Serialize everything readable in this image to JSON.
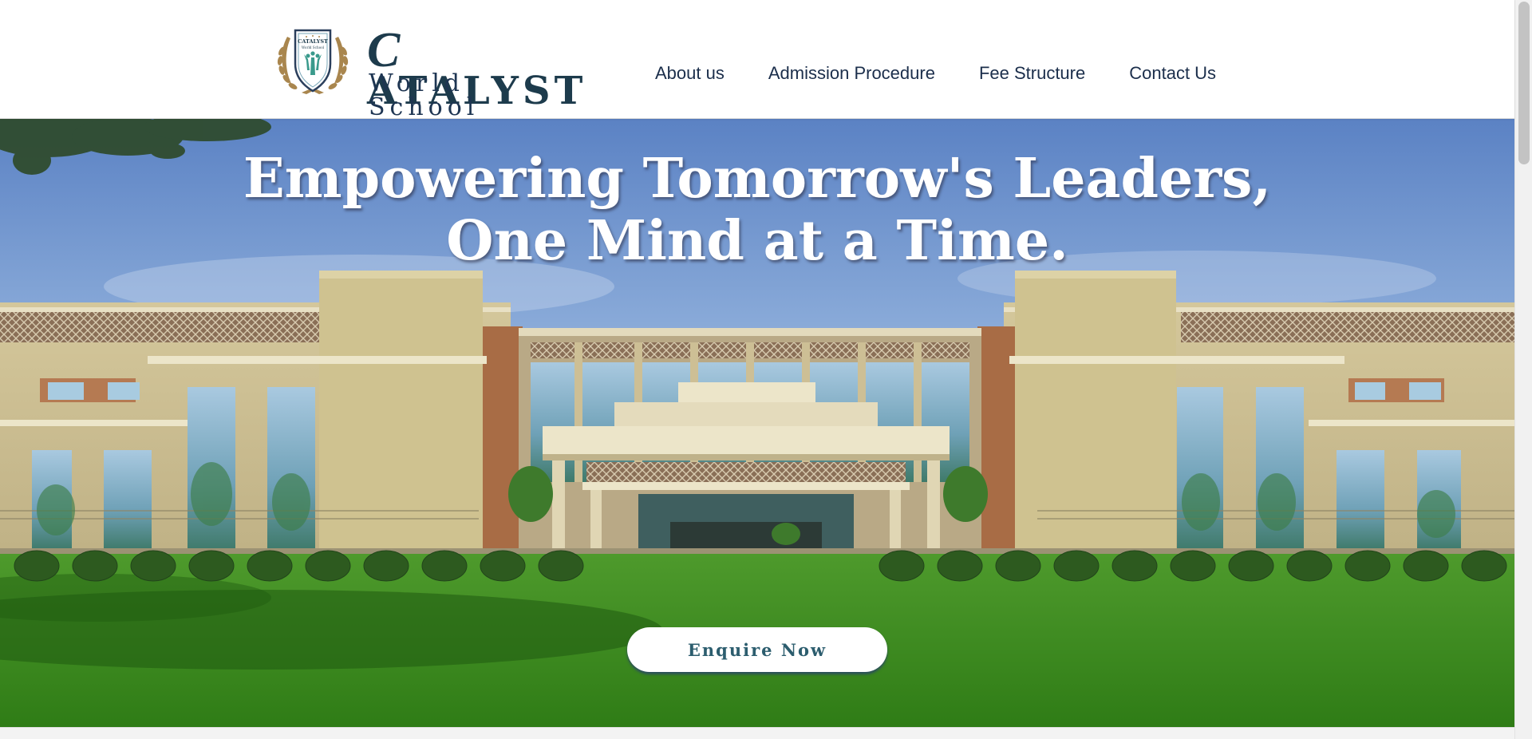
{
  "brand": {
    "name_top": "ATALYST",
    "name_top_initial": "C",
    "name_bottom": "World School",
    "crest_text_top": "CATALYST",
    "crest_text_bottom": "World School"
  },
  "nav": {
    "items": [
      {
        "label": "About us"
      },
      {
        "label": "Admission Procedure"
      },
      {
        "label": "Fee Structure"
      },
      {
        "label": "Contact Us"
      }
    ]
  },
  "hero": {
    "headline_line1": "Empowering Tomorrow's Leaders,",
    "headline_line2": "One Mind at a Time.",
    "cta_label": "Enquire Now",
    "image_icon": "school-building-image"
  },
  "colors": {
    "brand_navy": "#1b2e4b",
    "brand_teal": "#2c5d6e",
    "laurel_gold": "#a9864e",
    "sky_blue": "#7fa4d4",
    "lawn_green": "#3f8f22"
  }
}
